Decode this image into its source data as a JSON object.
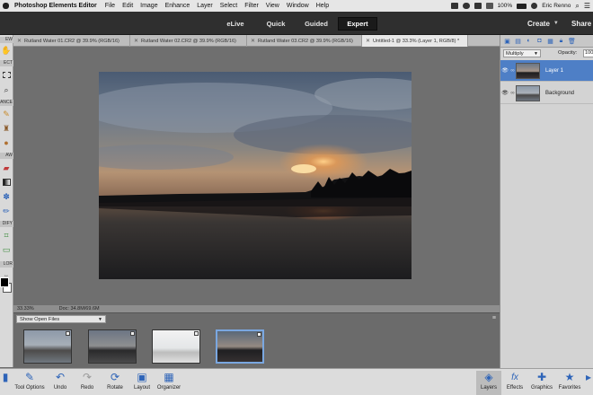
{
  "menubar": {
    "app_name": "Photoshop Elements Editor",
    "items": [
      "File",
      "Edit",
      "Image",
      "Enhance",
      "Layer",
      "Select",
      "Filter",
      "View",
      "Window",
      "Help"
    ],
    "battery": "100%",
    "user": "Eric Renno"
  },
  "modes": {
    "items": [
      "eLive",
      "Quick",
      "Guided",
      "Expert"
    ],
    "active": "Expert",
    "create_label": "Create",
    "share_label": "Share"
  },
  "tabs": [
    {
      "label": "Rutland Water 01.CR2 @ 39.9% (RGB/16)",
      "active": false
    },
    {
      "label": "Rutland Water 02.CR2 @ 39.9% (RGB/16)",
      "active": false
    },
    {
      "label": "Rutland Water 03.CR2 @ 39.9% (RGB/16)",
      "active": false
    },
    {
      "label": "Untitled-1 @ 33.3% (Layer 1, RGB/8) *",
      "active": true
    }
  ],
  "toolbar_sections": [
    "EW",
    "ECT",
    "ANCE",
    "AW",
    "DIFY",
    "LOR"
  ],
  "status": {
    "zoom": "33.33%",
    "doc": "Doc: 34.8M/69.6M"
  },
  "photo_bin": {
    "selector": "Show Open Files"
  },
  "layers_panel": {
    "blend_mode": "Multiply",
    "opacity_label": "Opacity:",
    "opacity_value": "100",
    "layers": [
      {
        "name": "Layer 1",
        "active": true
      },
      {
        "name": "Background",
        "active": false
      }
    ]
  },
  "taskbar": {
    "left": [
      "Tool Options",
      "Undo",
      "Redo",
      "Rotate",
      "Layout",
      "Organizer"
    ],
    "right": [
      "Layers",
      "Effects",
      "Graphics",
      "Favorites"
    ]
  },
  "colors": {
    "active_layer": "#4e7fc6",
    "accent_blue": "#2e64b8",
    "mode_bar": "#2f2f2f"
  }
}
